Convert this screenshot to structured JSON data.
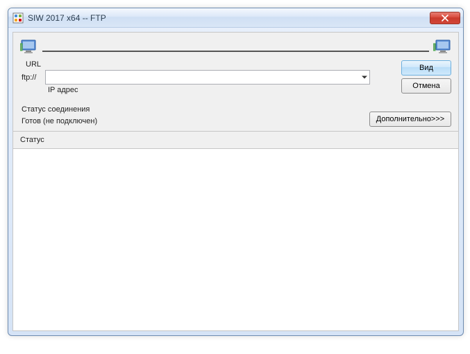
{
  "window": {
    "title": "SIW 2017 x64 -- FTP"
  },
  "form": {
    "url_label": "URL",
    "protocol": "ftp://",
    "url_value": "",
    "ip_label": "IP адрес"
  },
  "buttons": {
    "view": "Вид",
    "cancel": "Отмена",
    "more": "Дополнительно>>>"
  },
  "connection": {
    "status_label": "Статус соединения",
    "status_value": "Готов (не подключен)"
  },
  "status": {
    "header": "Статус"
  }
}
